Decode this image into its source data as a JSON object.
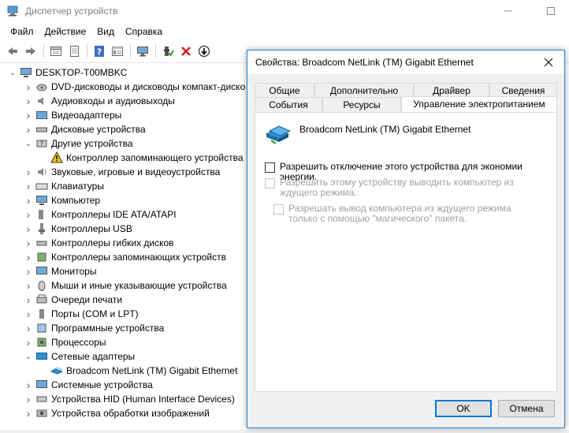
{
  "window": {
    "title": "Диспетчер устройств"
  },
  "menu": [
    "Файл",
    "Действие",
    "Вид",
    "Справка"
  ],
  "toolbar": {
    "icons": [
      "back-arrow-icon",
      "forward-arrow-icon",
      "properties-icon",
      "update-driver-icon",
      "help-icon",
      "details-view-icon",
      "scan-hardware-icon",
      "enable-device-icon",
      "uninstall-icon",
      "download-icon"
    ]
  },
  "tree": {
    "root": "DESKTOP-T00MBKC",
    "items": [
      {
        "label": "DVD-дисководы и дисководы компакт-диско",
        "expanded": false
      },
      {
        "label": "Аудиовходы и аудиовыходы",
        "expanded": false
      },
      {
        "label": "Видеоадаптеры",
        "expanded": false
      },
      {
        "label": "Дисковые устройства",
        "expanded": false
      },
      {
        "label": "Другие устройства",
        "expanded": true
      },
      {
        "label": "Контроллер запоминающего устройства",
        "child": true
      },
      {
        "label": "Звуковые, игровые и видеоустройства",
        "expanded": false
      },
      {
        "label": "Клавиатуры",
        "expanded": false
      },
      {
        "label": "Компьютер",
        "expanded": false
      },
      {
        "label": "Контроллеры IDE ATA/ATAPI",
        "expanded": false
      },
      {
        "label": "Контроллеры USB",
        "expanded": false
      },
      {
        "label": "Контроллеры гибких дисков",
        "expanded": false
      },
      {
        "label": "Контроллеры запоминающих устройств",
        "expanded": false
      },
      {
        "label": "Мониторы",
        "expanded": false
      },
      {
        "label": "Мыши и иные указывающие устройства",
        "expanded": false
      },
      {
        "label": "Очереди печати",
        "expanded": false
      },
      {
        "label": "Порты (COM и LPT)",
        "expanded": false
      },
      {
        "label": "Программные устройства",
        "expanded": false
      },
      {
        "label": "Процессоры",
        "expanded": false
      },
      {
        "label": "Сетевые адаптеры",
        "expanded": true
      },
      {
        "label": "Broadcom NetLink (TM) Gigabit Ethernet",
        "child": true
      },
      {
        "label": "Системные устройства",
        "expanded": false
      },
      {
        "label": "Устройства HID (Human Interface Devices)",
        "expanded": false
      },
      {
        "label": "Устройства обработки изображений",
        "expanded": false
      }
    ]
  },
  "dialog": {
    "title": "Свойства: Broadcom NetLink (TM) Gigabit Ethernet",
    "tabs_row1": [
      "Общие",
      "Дополнительно",
      "Драйвер",
      "Сведения"
    ],
    "tabs_row2": [
      "События",
      "Ресурсы",
      "Управление электропитанием"
    ],
    "active_tab": "Управление электропитанием",
    "device_name": "Broadcom NetLink (TM) Gigabit Ethernet",
    "options": [
      {
        "label": "Разрешить отключение этого устройства для экономии энергии.",
        "checked": false,
        "enabled": true
      },
      {
        "label": "Разрешить этому устройству выводить компьютер из ждущего режима.",
        "checked": false,
        "enabled": false
      },
      {
        "label": "Разрешать вывод компьютера из ждущего режима только с помощью \"магического\" пакета.",
        "checked": false,
        "enabled": false
      }
    ],
    "ok_label": "OK",
    "cancel_label": "Отмена"
  },
  "colors": {
    "accent": "#0078d7",
    "dialog_border": "#1883d7",
    "warning": "#f5c400",
    "disabled_text": "#a0a0a0"
  }
}
